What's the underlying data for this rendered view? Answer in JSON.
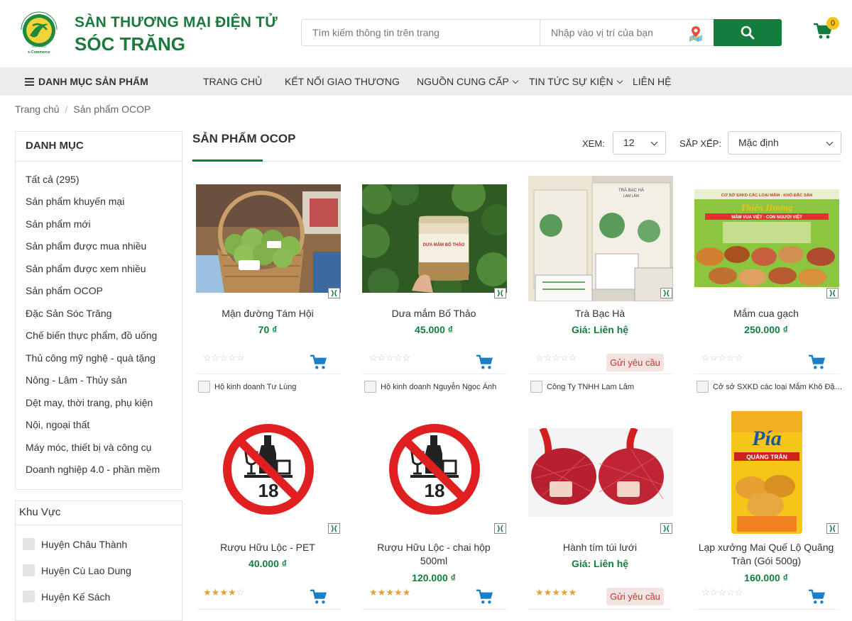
{
  "header": {
    "brand_line1": "SÀN THƯƠNG MẠI ĐIỆN TỬ",
    "brand_line2": "SÓC TRĂNG",
    "logo_ring_text": "SÀN THƯƠNG MẠI ĐIỆN TỬ",
    "logo_sub": "e-Commerce",
    "logo_mark": "SÓC TRĂNG",
    "search_placeholder": "Tìm kiếm thông tin trên trang",
    "location_placeholder": "Nhập vào vị trí của bạn",
    "cart_count": "0",
    "accent": "#137d3e"
  },
  "nav": {
    "category_menu": "DANH MỤC SẢN PHẨM",
    "items": [
      "TRANG CHỦ",
      "KẾT NỐI GIAO THƯƠNG",
      "NGUỒN CUNG CẤP",
      "TIN TỨC SỰ KIỆN",
      "LIÊN HỆ"
    ]
  },
  "breadcrumb": {
    "home": "Trang chủ",
    "current": "Sản phẩm OCOP"
  },
  "sidebar": {
    "category_title": "DANH MỤC",
    "categories": [
      "Tất cả (295)",
      "Sản phẩm khuyến mại",
      "Sản phẩm mới",
      "Sản phẩm được mua nhiều",
      "Sản phẩm được xem nhiều",
      "Sản phẩm OCOP",
      "Đặc Sản Sóc Trăng",
      "Chế biến thực phẩm, đồ uống",
      "Thủ công mỹ nghệ - quà tặng",
      "Nông - Lâm - Thủy sản",
      "Dệt may, thời trang, phụ kiện",
      "Nội, ngoại thất",
      "Máy móc, thiết bị và công cụ",
      "Doanh nghiệp 4.0 - phần mềm"
    ],
    "region_title": "Khu Vực",
    "regions": [
      "Huyện Châu Thành",
      "Huyện Cù Lao Dung",
      "Huyện Kế Sách"
    ]
  },
  "main": {
    "title": "SẢN PHẨM OCOP",
    "view_label": "XEM:",
    "view_value": "12",
    "sort_label": "SẮP XẾP:",
    "sort_value": "Mặc định"
  },
  "products": [
    {
      "name": "Mận đường Tám Hội",
      "price": "70 ₫",
      "rating": 0,
      "seller": "Hộ kinh doanh Tư Lùng",
      "action": "cart",
      "image": "basket-of-fruit"
    },
    {
      "name": "Dưa mắm Bố Thảo",
      "price": "45.000 ₫",
      "rating": 0,
      "seller": "Hộ kinh doanh Nguyễn Ngọc Ánh",
      "action": "cart",
      "image": "jar-of-pickles",
      "jar_label": "DƯA MẮM BỐ THẢO"
    },
    {
      "name": "Trà Bạc Hà",
      "price": "Giá: Liên hệ",
      "rating": 0,
      "seller": "Công Ty TNHH Lam Lâm",
      "action": "request",
      "action_label": "Gửi yêu cầu",
      "image": "tea-bags",
      "bag_label": "TRÀ BẠC HÀ",
      "bag_sub": "LAM LÂM"
    },
    {
      "name": "Mắm cua gạch",
      "price": "250.000 ₫",
      "rating": 0,
      "seller": "Cở sở SXKD các loại Mắm Khô Đặc ...",
      "action": "cart",
      "image": "poster-dishes",
      "poster_line1": "CƠ SỞ SXKD CÁC LOẠI MẮM - KHÔ ĐẶC SẢN",
      "poster_line2": "Thiên Hương",
      "poster_line3": "MẮM VUA VIỆT · CON NGƯỜI VIỆT"
    },
    {
      "name": "Rượu Hữu Lộc - PET",
      "price": "40.000 ₫",
      "rating": 4,
      "seller": "",
      "action": "cart",
      "image": "no-alcohol-18",
      "sign_text": "18"
    },
    {
      "name": "Rượu Hữu Lộc - chai hộp 500ml",
      "price": "120.000 ₫",
      "rating": 5,
      "seller": "",
      "action": "cart",
      "image": "no-alcohol-18",
      "sign_text": "18"
    },
    {
      "name": "Hành tím túi lưới",
      "price": "Giá: Liên hệ",
      "rating": 5,
      "seller": "",
      "action": "request",
      "action_label": "Gửi yêu cầu",
      "image": "red-onion-nets"
    },
    {
      "name": "Lạp xưởng Mai Quế Lộ Quãng Trân (Gói 500g)",
      "price": "160.000 ₫",
      "rating": 0,
      "seller": "",
      "action": "cart",
      "image": "sausage-pack",
      "pack_brand": "Pía",
      "pack_sub": "QUẢNG TRÂN"
    }
  ]
}
